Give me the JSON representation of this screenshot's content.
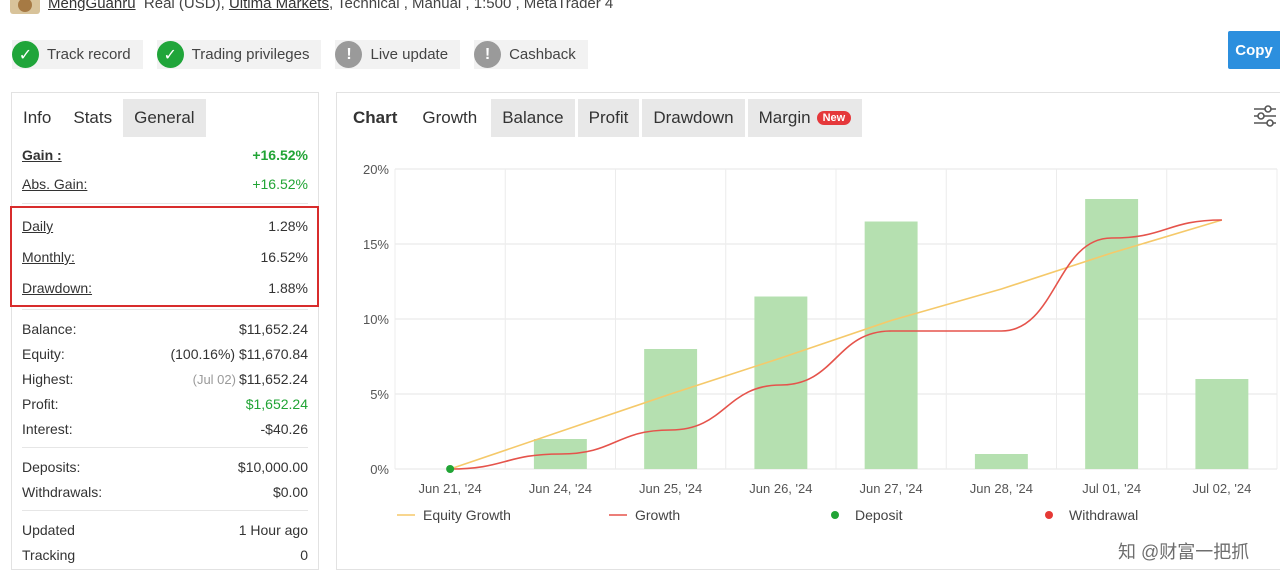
{
  "header": {
    "user": "MengGuanru",
    "account_type": "Real (USD),",
    "broker": "Ultima Markets",
    "rest": ", Technical , Manual , 1:500 , MetaTrader 4"
  },
  "badges": [
    {
      "label": "Track record",
      "state": "ok"
    },
    {
      "label": "Trading privileges",
      "state": "ok"
    },
    {
      "label": "Live update",
      "state": "warn"
    },
    {
      "label": "Cashback",
      "state": "warn"
    }
  ],
  "copy_button": "Copy",
  "left_tabs": [
    "Info",
    "Stats",
    "General"
  ],
  "stats": {
    "gain": {
      "label": "Gain :",
      "value": "+16.52%"
    },
    "abs_gain": {
      "label": "Abs. Gain:",
      "value": "+16.52%"
    },
    "daily": {
      "label": "Daily",
      "value": "1.28%"
    },
    "monthly": {
      "label": "Monthly:",
      "value": "16.52%"
    },
    "drawdown": {
      "label": "Drawdown:",
      "value": "1.88%"
    },
    "balance": {
      "label": "Balance:",
      "value": "$11,652.24"
    },
    "equity": {
      "label": "Equity:",
      "prefix": "(100.16%)",
      "value": "$11,670.84"
    },
    "highest": {
      "label": "Highest:",
      "prefix": "(Jul 02)",
      "value": "$11,652.24"
    },
    "profit": {
      "label": "Profit:",
      "value": "$1,652.24"
    },
    "interest": {
      "label": "Interest:",
      "value": "-$40.26"
    },
    "deposits": {
      "label": "Deposits:",
      "value": "$10,000.00"
    },
    "withdrawals": {
      "label": "Withdrawals:",
      "value": "$0.00"
    },
    "updated": {
      "label": "Updated",
      "value": "1 Hour ago"
    },
    "tracking": {
      "label": "Tracking",
      "value": "0"
    }
  },
  "right_tabs": {
    "chart": "Chart",
    "growth": "Growth",
    "balance": "Balance",
    "profit": "Profit",
    "drawdown": "Drawdown",
    "margin": "Margin",
    "new_badge": "New"
  },
  "watermark": "知 @财富一把抓",
  "chart_data": {
    "type": "bar",
    "categories": [
      "Jun 21, '24",
      "Jun 24, '24",
      "Jun 25, '24",
      "Jun 26, '24",
      "Jun 27, '24",
      "Jun 28, '24",
      "Jul 01, '24",
      "Jul 02, '24"
    ],
    "y_ticks": [
      "0%",
      "5%",
      "10%",
      "15%",
      "20%"
    ],
    "ylim": [
      0,
      20
    ],
    "grid": true,
    "legend_position": "bottom",
    "bars": {
      "name": "",
      "color": "#b5e0b0",
      "values": [
        0,
        2.0,
        8.0,
        11.5,
        16.5,
        1.0,
        18.0,
        6.0
      ]
    },
    "equity_growth": {
      "name": "Equity Growth",
      "color": "#f5c96a",
      "values": [
        0,
        2.5,
        5.0,
        7.4,
        9.9,
        12.0,
        14.4,
        16.6
      ]
    },
    "growth": {
      "name": "Growth",
      "color": "#e5534b",
      "values": [
        0,
        1.0,
        2.6,
        5.6,
        9.2,
        9.2,
        15.4,
        16.6
      ]
    },
    "deposit": {
      "name": "Deposit",
      "color": "#21a435",
      "x_index": 0,
      "y": 0
    },
    "withdrawal": {
      "name": "Withdrawal",
      "color": "#e53935"
    }
  }
}
